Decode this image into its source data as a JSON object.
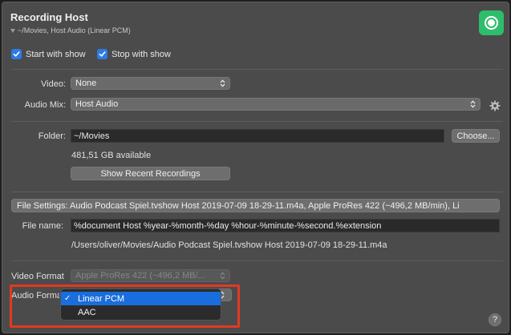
{
  "header": {
    "title": "Recording Host",
    "subtitle": "~/Movies, Host Audio (Linear PCM)"
  },
  "options": {
    "start_with_show": "Start with show",
    "stop_with_show": "Stop with show"
  },
  "video": {
    "label": "Video:",
    "value": "None"
  },
  "audio_mix": {
    "label": "Audio Mix:",
    "value": "Host Audio"
  },
  "folder": {
    "label": "Folder:",
    "value": "~/Movies",
    "choose_label": "Choose...",
    "available": "481,51 GB available",
    "show_recent_label": "Show Recent Recordings"
  },
  "file_settings": {
    "label": "File Settings: Audio Podcast Spiel.tvshow Host 2019-07-09 18-29-11.m4a, Apple ProRes 422 (~496,2 MB/min), Li"
  },
  "file_name": {
    "label": "File name:",
    "value": "%document Host %year-%month-%day %hour-%minute-%second.%extension",
    "path_preview": "/Users/oliver/Movies/Audio Podcast Spiel.tvshow Host 2019-07-09 18-29-11.m4a"
  },
  "video_format": {
    "label": "Video Format",
    "value": "Apple ProRes 422 (~496,2 MB/..."
  },
  "audio_format": {
    "label": "Audio Format",
    "options": [
      "Linear PCM",
      "AAC"
    ],
    "selected": "Linear PCM"
  },
  "help": {
    "label": "?"
  },
  "colors": {
    "accent": "#2c7be5",
    "record": "#2ebd6b",
    "highlight": "#e23a20"
  }
}
